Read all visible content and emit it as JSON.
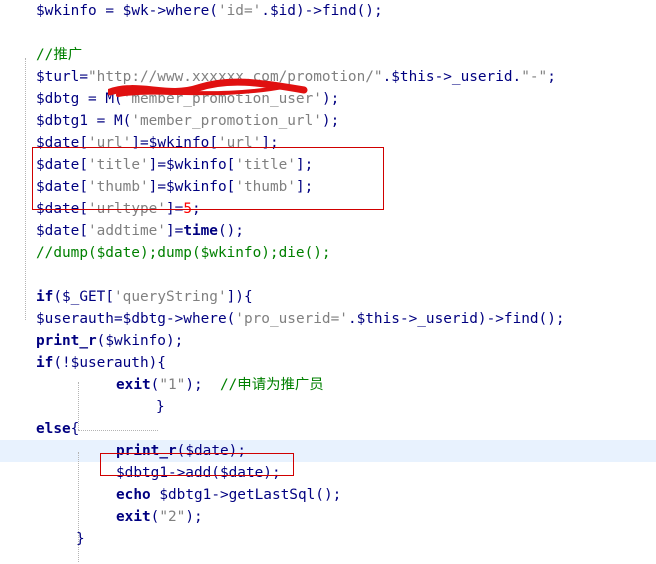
{
  "editor": {
    "colors": {
      "variable": "#000080",
      "string": "#808080",
      "keyword": "#000080",
      "comment": "#008000",
      "number": "#ff0000",
      "highlight": "#e8f2fe",
      "annotation": "#d00000"
    },
    "lines": [
      {
        "indent": 36,
        "tokens": [
          [
            "var",
            "$wkinfo"
          ],
          [
            "pun",
            " = "
          ],
          [
            "var",
            "$wk"
          ],
          [
            "pun",
            "->where("
          ],
          [
            "str",
            "'id='"
          ],
          [
            "pun",
            "."
          ],
          [
            "var",
            "$id"
          ],
          [
            "pun",
            ")->find();"
          ]
        ]
      },
      {
        "indent": 36,
        "tokens": []
      },
      {
        "indent": 36,
        "tokens": [
          [
            "cmt",
            "//推广"
          ]
        ]
      },
      {
        "indent": 36,
        "tokens": [
          [
            "var",
            "$turl"
          ],
          [
            "pun",
            "="
          ],
          [
            "str",
            "\"http://www.xxxxxx.com/promotion/\""
          ],
          [
            "pun",
            "."
          ],
          [
            "var",
            "$this"
          ],
          [
            "pun",
            "->_userid."
          ],
          [
            "str",
            "\"-\""
          ],
          [
            "pun",
            ";"
          ]
        ]
      },
      {
        "indent": 36,
        "tokens": [
          [
            "var",
            "$dbtg"
          ],
          [
            "pun",
            " = M("
          ],
          [
            "str",
            "'member_promotion_user'"
          ],
          [
            "pun",
            ");"
          ]
        ]
      },
      {
        "indent": 36,
        "tokens": [
          [
            "var",
            "$dbtg1"
          ],
          [
            "pun",
            " = M("
          ],
          [
            "str",
            "'member_promotion_url'"
          ],
          [
            "pun",
            ");"
          ]
        ]
      },
      {
        "indent": 36,
        "tokens": [
          [
            "var",
            "$date"
          ],
          [
            "pun",
            "["
          ],
          [
            "str",
            "'url'"
          ],
          [
            "pun",
            "]="
          ],
          [
            "var",
            "$wkinfo"
          ],
          [
            "pun",
            "["
          ],
          [
            "str",
            "'url'"
          ],
          [
            "pun",
            "];"
          ]
        ]
      },
      {
        "indent": 36,
        "tokens": [
          [
            "var",
            "$date"
          ],
          [
            "pun",
            "["
          ],
          [
            "str",
            "'title'"
          ],
          [
            "pun",
            "]="
          ],
          [
            "var",
            "$wkinfo"
          ],
          [
            "pun",
            "["
          ],
          [
            "str",
            "'title'"
          ],
          [
            "pun",
            "];"
          ]
        ]
      },
      {
        "indent": 36,
        "tokens": [
          [
            "var",
            "$date"
          ],
          [
            "pun",
            "["
          ],
          [
            "str",
            "'thumb'"
          ],
          [
            "pun",
            "]="
          ],
          [
            "var",
            "$wkinfo"
          ],
          [
            "pun",
            "["
          ],
          [
            "str",
            "'thumb'"
          ],
          [
            "pun",
            "];"
          ]
        ]
      },
      {
        "indent": 36,
        "tokens": [
          [
            "var",
            "$date"
          ],
          [
            "pun",
            "["
          ],
          [
            "str",
            "'urltype'"
          ],
          [
            "pun",
            "]="
          ],
          [
            "num",
            "5"
          ],
          [
            "pun",
            ";"
          ]
        ]
      },
      {
        "indent": 36,
        "tokens": [
          [
            "var",
            "$date"
          ],
          [
            "pun",
            "["
          ],
          [
            "str",
            "'addtime'"
          ],
          [
            "pun",
            "]="
          ],
          [
            "kw",
            "time"
          ],
          [
            "pun",
            "();"
          ]
        ]
      },
      {
        "indent": 36,
        "tokens": [
          [
            "cmt",
            "//dump($date);dump($wkinfo);die();"
          ]
        ]
      },
      {
        "indent": 36,
        "tokens": []
      },
      {
        "indent": 36,
        "tokens": [
          [
            "kw",
            "if"
          ],
          [
            "pun",
            "("
          ],
          [
            "var",
            "$_GET"
          ],
          [
            "pun",
            "["
          ],
          [
            "str",
            "'queryString'"
          ],
          [
            "pun",
            "]){"
          ]
        ]
      },
      {
        "indent": 36,
        "tokens": [
          [
            "var",
            "$userauth"
          ],
          [
            "pun",
            "="
          ],
          [
            "var",
            "$dbtg"
          ],
          [
            "pun",
            "->where("
          ],
          [
            "str",
            "'pro_userid='"
          ],
          [
            "pun",
            "."
          ],
          [
            "var",
            "$this"
          ],
          [
            "pun",
            "->_userid)->find();"
          ]
        ]
      },
      {
        "indent": 36,
        "tokens": [
          [
            "kw",
            "print_r"
          ],
          [
            "pun",
            "("
          ],
          [
            "var",
            "$wkinfo"
          ],
          [
            "pun",
            ");"
          ]
        ]
      },
      {
        "indent": 36,
        "tokens": [
          [
            "kw",
            "if"
          ],
          [
            "pun",
            "(!"
          ],
          [
            "var",
            "$userauth"
          ],
          [
            "pun",
            "){"
          ]
        ]
      },
      {
        "indent": 116,
        "tokens": [
          [
            "kw",
            "exit"
          ],
          [
            "pun",
            "("
          ],
          [
            "str",
            "\"1\""
          ],
          [
            "pun",
            ");  "
          ],
          [
            "cmt",
            "//申请为推广员"
          ]
        ]
      },
      {
        "indent": 156,
        "tokens": [
          [
            "pun",
            "}"
          ]
        ]
      },
      {
        "indent": 36,
        "tokens": [
          [
            "kw",
            "else"
          ],
          [
            "pun",
            "{"
          ]
        ]
      },
      {
        "indent": 116,
        "current": true,
        "tokens": [
          [
            "kw",
            "print_r"
          ],
          [
            "pun",
            "("
          ],
          [
            "var",
            "$date"
          ],
          [
            "pun",
            ");"
          ]
        ]
      },
      {
        "indent": 116,
        "tokens": [
          [
            "var",
            "$dbtg1"
          ],
          [
            "pun",
            "->add("
          ],
          [
            "var",
            "$date"
          ],
          [
            "pun",
            ");"
          ]
        ]
      },
      {
        "indent": 116,
        "tokens": [
          [
            "kw",
            "echo"
          ],
          [
            "pun",
            " "
          ],
          [
            "var",
            "$dbtg1"
          ],
          [
            "pun",
            "->getLastSql();"
          ]
        ]
      },
      {
        "indent": 116,
        "tokens": [
          [
            "kw",
            "exit"
          ],
          [
            "pun",
            "("
          ],
          [
            "str",
            "\"2\""
          ],
          [
            "pun",
            ");"
          ]
        ]
      },
      {
        "indent": 76,
        "tokens": [
          [
            "pun",
            "}"
          ]
        ]
      }
    ]
  }
}
